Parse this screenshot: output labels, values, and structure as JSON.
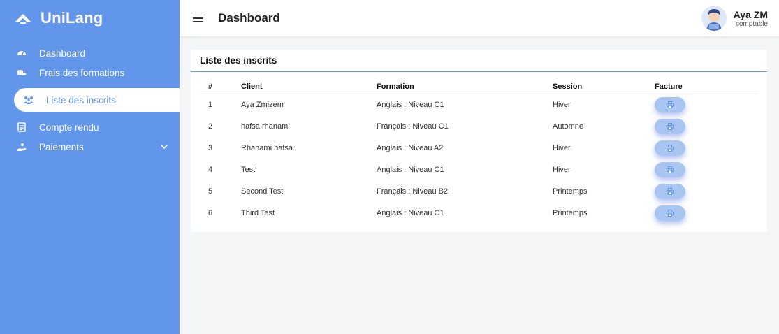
{
  "brand": {
    "name": "UniLang"
  },
  "sidebar": {
    "items": [
      {
        "label": "Dashboard",
        "icon": "dashboard-icon"
      },
      {
        "label": "Frais des formations",
        "icon": "coins-icon"
      },
      {
        "label": "Liste des inscrits",
        "icon": "users-icon",
        "active": true
      },
      {
        "label": "Compte rendu",
        "icon": "document-icon"
      },
      {
        "label": "Paiements",
        "icon": "hand-coin-icon",
        "has_submenu": true
      }
    ]
  },
  "header": {
    "title": "Dashboard"
  },
  "user": {
    "name": "Aya ZM",
    "role": "comptable"
  },
  "card": {
    "title": "Liste des inscrits"
  },
  "table": {
    "columns": [
      "#",
      "Client",
      "Formation",
      "Session",
      "Facture"
    ],
    "rows": [
      {
        "num": "1",
        "client": "Aya Zmizem",
        "formation": "Anglais : Niveau C1",
        "session": "Hiver"
      },
      {
        "num": "2",
        "client": "hafsa rhanami",
        "formation": "Français : Niveau C1",
        "session": "Automne"
      },
      {
        "num": "3",
        "client": "Rhanami hafsa",
        "formation": "Anglais : Niveau A2",
        "session": "Hiver"
      },
      {
        "num": "4",
        "client": "Test",
        "formation": "Anglais : Niveau C1",
        "session": "Hiver"
      },
      {
        "num": "5",
        "client": "Second Test",
        "formation": "Français : Niveau B2",
        "session": "Printemps"
      },
      {
        "num": "6",
        "client": "Third Test",
        "formation": "Anglais : Niveau C1",
        "session": "Printemps"
      }
    ]
  },
  "colors": {
    "accent": "#6196ea",
    "button": "#a9c6f3"
  }
}
